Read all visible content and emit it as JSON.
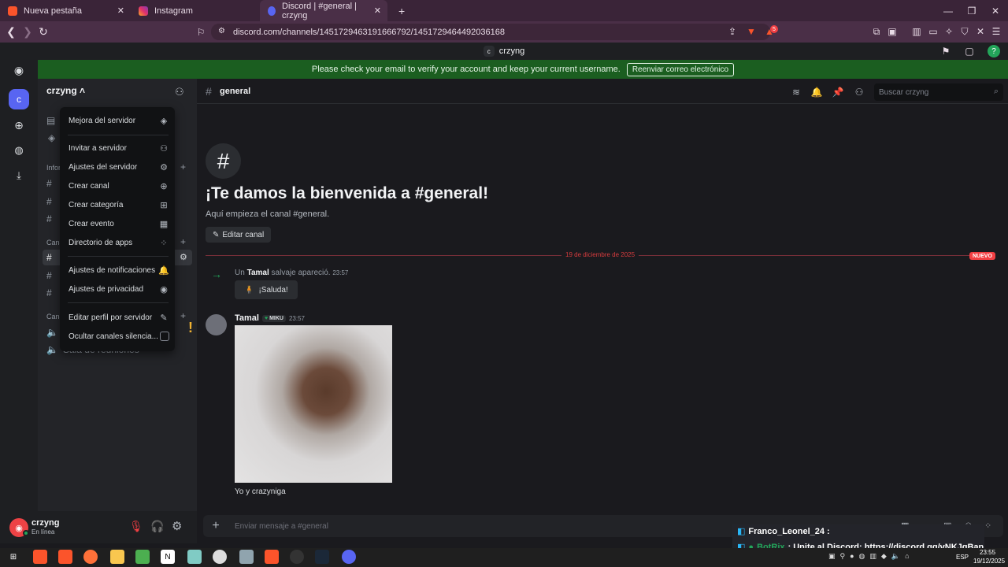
{
  "browser": {
    "tabs": [
      {
        "label": "Nueva pestaña"
      },
      {
        "label": "Instagram"
      },
      {
        "label": "Discord | #general | crzyng"
      }
    ],
    "url": "discord.com/channels/1451729463191666792/1451729464492036168",
    "shield_badge": "5"
  },
  "top_title": {
    "initial": "c",
    "name": "crzyng"
  },
  "banner": {
    "text": "Please check your email to verify your account and keep your current username.",
    "button": "Reenviar correo electrónico"
  },
  "rail": {
    "server_initial": "c"
  },
  "sidebar": {
    "server_name": "crzyng",
    "cat_info": "Infor",
    "cat_text": "Cana",
    "cat_voice": "Cana",
    "voice_channel": "Sala de reuniones"
  },
  "menu": {
    "items": [
      {
        "label": "Mejora del servidor",
        "icon": "boost-icon"
      },
      {
        "label": "Invitar a servidor",
        "icon": "add-user-icon"
      },
      {
        "label": "Ajustes del servidor",
        "icon": "gear-icon"
      },
      {
        "label": "Crear canal",
        "icon": "plus-circle-icon"
      },
      {
        "label": "Crear categoría",
        "icon": "folder-plus-icon"
      },
      {
        "label": "Crear evento",
        "icon": "calendar-plus-icon"
      },
      {
        "label": "Directorio de apps",
        "icon": "apps-icon"
      },
      {
        "label": "Ajustes de notificaciones",
        "icon": "bell-icon"
      },
      {
        "label": "Ajustes de privacidad",
        "icon": "shield-icon"
      },
      {
        "label": "Editar perfil por servidor",
        "icon": "pencil-icon"
      },
      {
        "label": "Ocultar canales silencia...",
        "icon": "checkbox-icon"
      }
    ]
  },
  "channel": {
    "name": "general",
    "search_placeholder": "Buscar crzyng"
  },
  "welcome": {
    "title": "¡Te damos la bienvenida a #general!",
    "subtitle": "Aquí empieza el canal #general.",
    "edit_button": "Editar canal"
  },
  "divider": {
    "date": "19 de diciembre de 2025",
    "badge": "NUEVO"
  },
  "join": {
    "prefix": "Un",
    "user": "Tamal",
    "suffix": "salvaje apareció.",
    "time": "23:57",
    "wave_button": "¡Saluda!"
  },
  "message": {
    "author": "Tamal",
    "tag": "MIKU",
    "time": "23:57",
    "caption": "Yo y crazyniga"
  },
  "composer": {
    "placeholder": "Enviar mensaje a #general"
  },
  "user": {
    "name": "crzyng",
    "status": "En línea"
  },
  "overlay": {
    "line1": "Franco_Leonel_24 :",
    "line2_user": "BotRix",
    "line2_text": ": Unite al Discord: https://discord.gg/vNKJgBan"
  },
  "taskbar": {
    "lang": "ESP",
    "time": "23:55",
    "date": "19/12/2025"
  },
  "colors": {
    "brand": "#5865f2",
    "banner": "#1b5e20",
    "online": "#23a55a",
    "new": "#f23f43"
  }
}
